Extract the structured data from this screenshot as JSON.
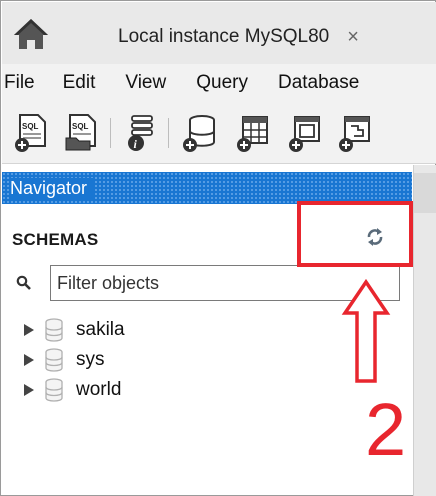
{
  "tab": {
    "title": "Local instance MySQL80",
    "close_glyph": "×"
  },
  "menu": [
    "File",
    "Edit",
    "View",
    "Query",
    "Database"
  ],
  "toolbar": {
    "icons": [
      "new-sql-tab-icon",
      "open-sql-script-icon",
      "info-icon",
      "create-schema-icon",
      "create-table-icon",
      "create-view-icon",
      "create-procedure-icon"
    ],
    "sql_label": "SQL"
  },
  "navigator": {
    "title": "Navigator",
    "section": "SCHEMAS",
    "filter_placeholder": "Filter objects",
    "schemas": [
      {
        "label": "sakila"
      },
      {
        "label": "sys"
      },
      {
        "label": "world"
      }
    ]
  },
  "annotation": {
    "number": "2",
    "color": "#e8262e"
  },
  "colors": {
    "navigator_header": "#1976d2",
    "tab_bar": "#e9e9e9",
    "toolbar": "#f2f2f2"
  }
}
